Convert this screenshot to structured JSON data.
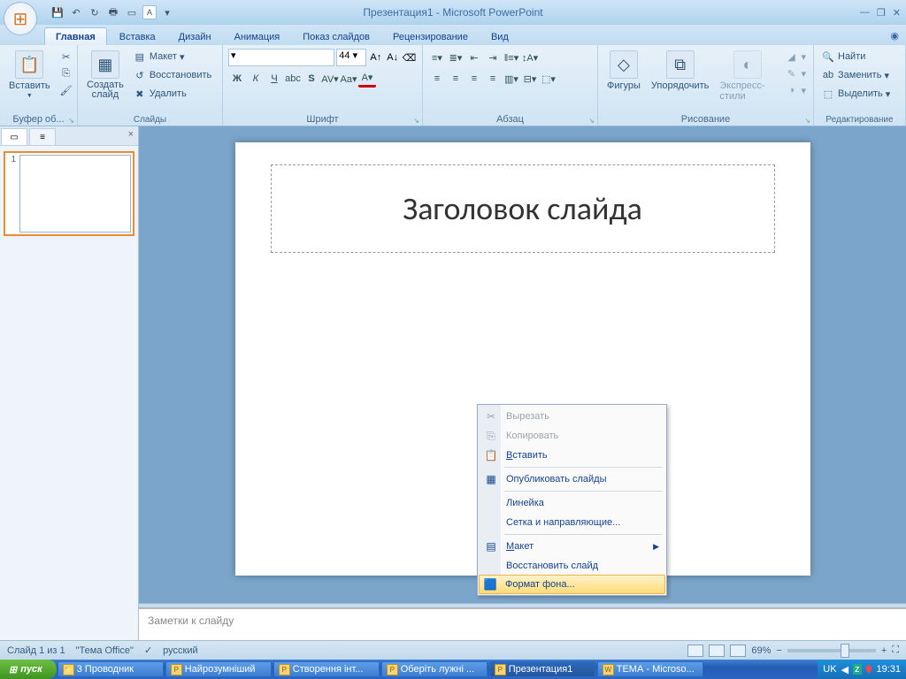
{
  "title": "Презентация1 - Microsoft PowerPoint",
  "tabs": [
    "Главная",
    "Вставка",
    "Дизайн",
    "Анимация",
    "Показ слайдов",
    "Рецензирование",
    "Вид"
  ],
  "activeTab": 0,
  "ribbon": {
    "clipboard": {
      "label": "Буфер об...",
      "paste": "Вставить"
    },
    "slides": {
      "label": "Слайды",
      "new": "Создать\nслайд",
      "layout": "Макет",
      "reset": "Восстановить",
      "delete": "Удалить"
    },
    "font": {
      "label": "Шрифт",
      "size": "44"
    },
    "paragraph": {
      "label": "Абзац"
    },
    "drawing": {
      "label": "Рисование",
      "shapes": "Фигуры",
      "arrange": "Упорядочить",
      "quick": "Экспресс-стили"
    },
    "editing": {
      "label": "Редактирование",
      "find": "Найти",
      "replace": "Заменить",
      "select": "Выделить"
    }
  },
  "slide": {
    "titlePlaceholder": "Заголовок слайда"
  },
  "notes": "Заметки к слайду",
  "status": {
    "slide": "Слайд 1 из 1",
    "theme": "\"Тема Office\"",
    "lang": "русский",
    "zoom": "69%"
  },
  "contextMenu": {
    "cut": "Вырезать",
    "copy": "Копировать",
    "paste": "Вставить",
    "publish": "Опубликовать слайды",
    "ruler": "Линейка",
    "grid": "Сетка и направляющие...",
    "layout": "Макет",
    "reset": "Восстановить слайд",
    "format": "Формат фона..."
  },
  "taskbar": {
    "start": "пуск",
    "items": [
      "3 Проводник",
      "Найрозумніший",
      "Створення інт...",
      "Оберіть лужні ...",
      "Презентация1",
      "ТЕМА - Microso..."
    ],
    "activeIndex": 4,
    "lang": "UK",
    "time": "19:31"
  }
}
